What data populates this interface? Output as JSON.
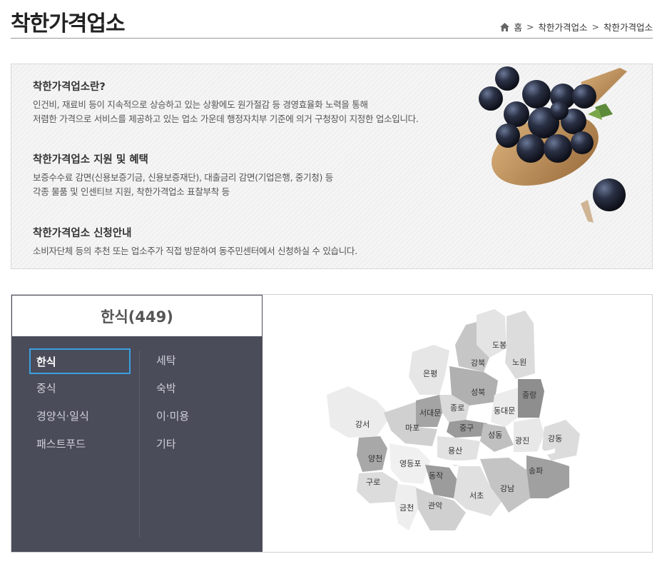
{
  "header": {
    "title": "착한가격업소",
    "breadcrumb": [
      "홈",
      "착한가격업소",
      "착한가격업소"
    ]
  },
  "info": {
    "sections": [
      {
        "heading": "착한가격업소란?",
        "lines": [
          "인건비, 재료비 등이 지속적으로 상승하고 있는 상황에도 원가절감 등 경영효율화 노력을 통해",
          "저렴한 가격으로 서비스를 제공하고 있는 업소 가운데 행정자치부 기준에 의거 구청장이 지정한 업소입니다."
        ]
      },
      {
        "heading": "착한가격업소 지원 및 혜택",
        "lines": [
          "보증수수료 감면(신용보증기금, 신용보증재단), 대출금리 감면(기업은행, 중기청) 등",
          "각종 물품 및 인센티브 지원, 착한가격업소 표찰부착 등"
        ]
      },
      {
        "heading": "착한가격업소 신청안내",
        "lines": [
          "소비자단체 등의 추천 또는 업소주가 직접 방문하여 동주민센터에서 신청하실 수 있습니다."
        ]
      }
    ]
  },
  "categories": {
    "header": "한식(449)",
    "left": [
      "한식",
      "중식",
      "경양식·일식",
      "패스트푸드"
    ],
    "right": [
      "세탁",
      "숙박",
      "이·미용",
      "기타"
    ],
    "active": "한식"
  },
  "map": {
    "districts": [
      "도봉",
      "노원",
      "강북",
      "은평",
      "성북",
      "중랑",
      "종로",
      "서대문",
      "동대문",
      "강서",
      "마포",
      "중구",
      "성동",
      "광진",
      "강동",
      "용산",
      "양천",
      "영등포",
      "동작",
      "송파",
      "구로",
      "강남",
      "서초",
      "금천",
      "관악"
    ]
  },
  "colors": {
    "panel": "#4a4c5a",
    "active_border": "#3aa0e0"
  }
}
